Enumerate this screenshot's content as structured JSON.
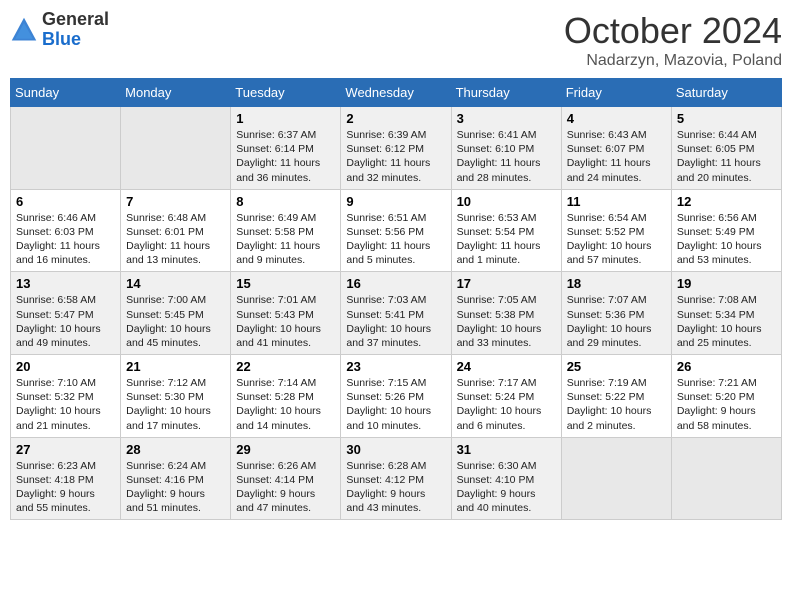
{
  "header": {
    "logo": {
      "general": "General",
      "blue": "Blue"
    },
    "title": "October 2024",
    "subtitle": "Nadarzyn, Mazovia, Poland"
  },
  "days_of_week": [
    "Sunday",
    "Monday",
    "Tuesday",
    "Wednesday",
    "Thursday",
    "Friday",
    "Saturday"
  ],
  "weeks": [
    [
      {
        "day": "",
        "empty": true
      },
      {
        "day": "",
        "empty": true
      },
      {
        "day": "1",
        "sunrise": "Sunrise: 6:37 AM",
        "sunset": "Sunset: 6:14 PM",
        "daylight": "Daylight: 11 hours and 36 minutes."
      },
      {
        "day": "2",
        "sunrise": "Sunrise: 6:39 AM",
        "sunset": "Sunset: 6:12 PM",
        "daylight": "Daylight: 11 hours and 32 minutes."
      },
      {
        "day": "3",
        "sunrise": "Sunrise: 6:41 AM",
        "sunset": "Sunset: 6:10 PM",
        "daylight": "Daylight: 11 hours and 28 minutes."
      },
      {
        "day": "4",
        "sunrise": "Sunrise: 6:43 AM",
        "sunset": "Sunset: 6:07 PM",
        "daylight": "Daylight: 11 hours and 24 minutes."
      },
      {
        "day": "5",
        "sunrise": "Sunrise: 6:44 AM",
        "sunset": "Sunset: 6:05 PM",
        "daylight": "Daylight: 11 hours and 20 minutes."
      }
    ],
    [
      {
        "day": "6",
        "sunrise": "Sunrise: 6:46 AM",
        "sunset": "Sunset: 6:03 PM",
        "daylight": "Daylight: 11 hours and 16 minutes."
      },
      {
        "day": "7",
        "sunrise": "Sunrise: 6:48 AM",
        "sunset": "Sunset: 6:01 PM",
        "daylight": "Daylight: 11 hours and 13 minutes."
      },
      {
        "day": "8",
        "sunrise": "Sunrise: 6:49 AM",
        "sunset": "Sunset: 5:58 PM",
        "daylight": "Daylight: 11 hours and 9 minutes."
      },
      {
        "day": "9",
        "sunrise": "Sunrise: 6:51 AM",
        "sunset": "Sunset: 5:56 PM",
        "daylight": "Daylight: 11 hours and 5 minutes."
      },
      {
        "day": "10",
        "sunrise": "Sunrise: 6:53 AM",
        "sunset": "Sunset: 5:54 PM",
        "daylight": "Daylight: 11 hours and 1 minute."
      },
      {
        "day": "11",
        "sunrise": "Sunrise: 6:54 AM",
        "sunset": "Sunset: 5:52 PM",
        "daylight": "Daylight: 10 hours and 57 minutes."
      },
      {
        "day": "12",
        "sunrise": "Sunrise: 6:56 AM",
        "sunset": "Sunset: 5:49 PM",
        "daylight": "Daylight: 10 hours and 53 minutes."
      }
    ],
    [
      {
        "day": "13",
        "sunrise": "Sunrise: 6:58 AM",
        "sunset": "Sunset: 5:47 PM",
        "daylight": "Daylight: 10 hours and 49 minutes."
      },
      {
        "day": "14",
        "sunrise": "Sunrise: 7:00 AM",
        "sunset": "Sunset: 5:45 PM",
        "daylight": "Daylight: 10 hours and 45 minutes."
      },
      {
        "day": "15",
        "sunrise": "Sunrise: 7:01 AM",
        "sunset": "Sunset: 5:43 PM",
        "daylight": "Daylight: 10 hours and 41 minutes."
      },
      {
        "day": "16",
        "sunrise": "Sunrise: 7:03 AM",
        "sunset": "Sunset: 5:41 PM",
        "daylight": "Daylight: 10 hours and 37 minutes."
      },
      {
        "day": "17",
        "sunrise": "Sunrise: 7:05 AM",
        "sunset": "Sunset: 5:38 PM",
        "daylight": "Daylight: 10 hours and 33 minutes."
      },
      {
        "day": "18",
        "sunrise": "Sunrise: 7:07 AM",
        "sunset": "Sunset: 5:36 PM",
        "daylight": "Daylight: 10 hours and 29 minutes."
      },
      {
        "day": "19",
        "sunrise": "Sunrise: 7:08 AM",
        "sunset": "Sunset: 5:34 PM",
        "daylight": "Daylight: 10 hours and 25 minutes."
      }
    ],
    [
      {
        "day": "20",
        "sunrise": "Sunrise: 7:10 AM",
        "sunset": "Sunset: 5:32 PM",
        "daylight": "Daylight: 10 hours and 21 minutes."
      },
      {
        "day": "21",
        "sunrise": "Sunrise: 7:12 AM",
        "sunset": "Sunset: 5:30 PM",
        "daylight": "Daylight: 10 hours and 17 minutes."
      },
      {
        "day": "22",
        "sunrise": "Sunrise: 7:14 AM",
        "sunset": "Sunset: 5:28 PM",
        "daylight": "Daylight: 10 hours and 14 minutes."
      },
      {
        "day": "23",
        "sunrise": "Sunrise: 7:15 AM",
        "sunset": "Sunset: 5:26 PM",
        "daylight": "Daylight: 10 hours and 10 minutes."
      },
      {
        "day": "24",
        "sunrise": "Sunrise: 7:17 AM",
        "sunset": "Sunset: 5:24 PM",
        "daylight": "Daylight: 10 hours and 6 minutes."
      },
      {
        "day": "25",
        "sunrise": "Sunrise: 7:19 AM",
        "sunset": "Sunset: 5:22 PM",
        "daylight": "Daylight: 10 hours and 2 minutes."
      },
      {
        "day": "26",
        "sunrise": "Sunrise: 7:21 AM",
        "sunset": "Sunset: 5:20 PM",
        "daylight": "Daylight: 9 hours and 58 minutes."
      }
    ],
    [
      {
        "day": "27",
        "sunrise": "Sunrise: 6:23 AM",
        "sunset": "Sunset: 4:18 PM",
        "daylight": "Daylight: 9 hours and 55 minutes."
      },
      {
        "day": "28",
        "sunrise": "Sunrise: 6:24 AM",
        "sunset": "Sunset: 4:16 PM",
        "daylight": "Daylight: 9 hours and 51 minutes."
      },
      {
        "day": "29",
        "sunrise": "Sunrise: 6:26 AM",
        "sunset": "Sunset: 4:14 PM",
        "daylight": "Daylight: 9 hours and 47 minutes."
      },
      {
        "day": "30",
        "sunrise": "Sunrise: 6:28 AM",
        "sunset": "Sunset: 4:12 PM",
        "daylight": "Daylight: 9 hours and 43 minutes."
      },
      {
        "day": "31",
        "sunrise": "Sunrise: 6:30 AM",
        "sunset": "Sunset: 4:10 PM",
        "daylight": "Daylight: 9 hours and 40 minutes."
      },
      {
        "day": "",
        "empty": true
      },
      {
        "day": "",
        "empty": true
      }
    ]
  ]
}
